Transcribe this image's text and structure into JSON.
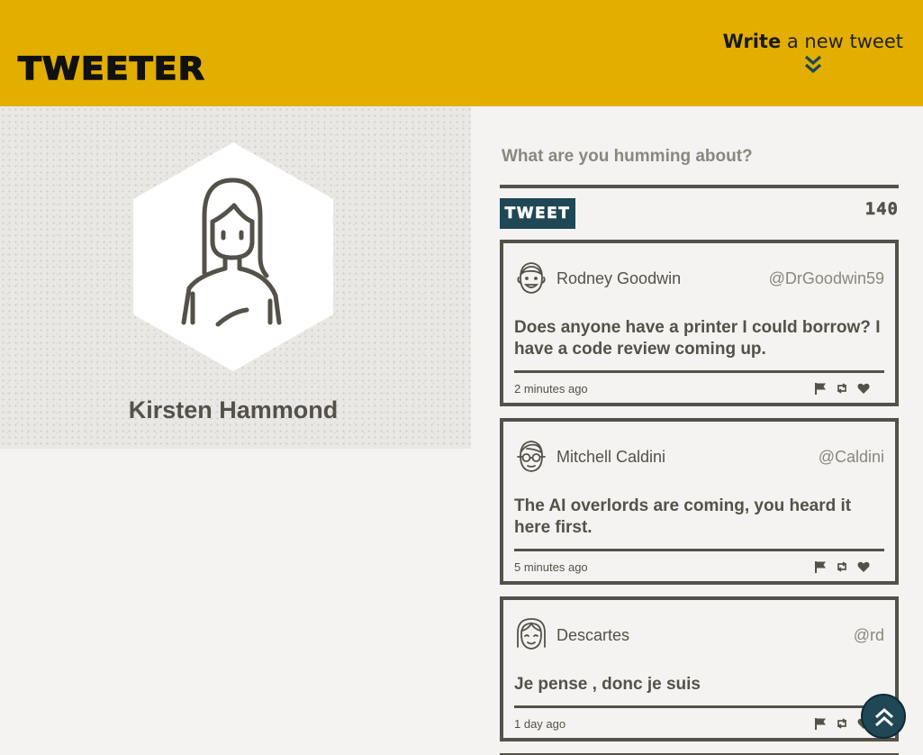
{
  "nav": {
    "brand": "TWEETER",
    "compose_bold": "Write",
    "compose_rest": " a new tweet",
    "chevron_icon": "double-chevron-down-icon"
  },
  "profile": {
    "name": "Kirsten Hammond",
    "avatar_icon": "woman-avatar-icon"
  },
  "compose": {
    "placeholder": "What are you humming about?",
    "button_label": "TWEET",
    "counter": "140"
  },
  "tweets": [
    {
      "author": "Rodney Goodwin",
      "handle": "@DrGoodwin59",
      "text": "Does anyone have a printer I could borrow? I have a code review coming up.",
      "time": "2 minutes ago",
      "avatar_icon": "man-avatar-icon"
    },
    {
      "author": "Mitchell Caldini",
      "handle": "@Caldini",
      "text": "The AI overlords are coming, you heard it here first.",
      "time": "5 minutes ago",
      "avatar_icon": "glasses-avatar-icon"
    },
    {
      "author": "Descartes",
      "handle": "@rd",
      "text": "Je pense , donc je suis",
      "time": "1 day ago",
      "avatar_icon": "girl-avatar-icon"
    }
  ],
  "actions": [
    "flag-icon",
    "retweet-icon",
    "heart-icon"
  ],
  "scroll_top_icon": "double-chevron-up-icon",
  "colors": {
    "header": "#e2ae00",
    "text": "#545149",
    "button": "#1f4755",
    "background": "#f4f3f1"
  }
}
